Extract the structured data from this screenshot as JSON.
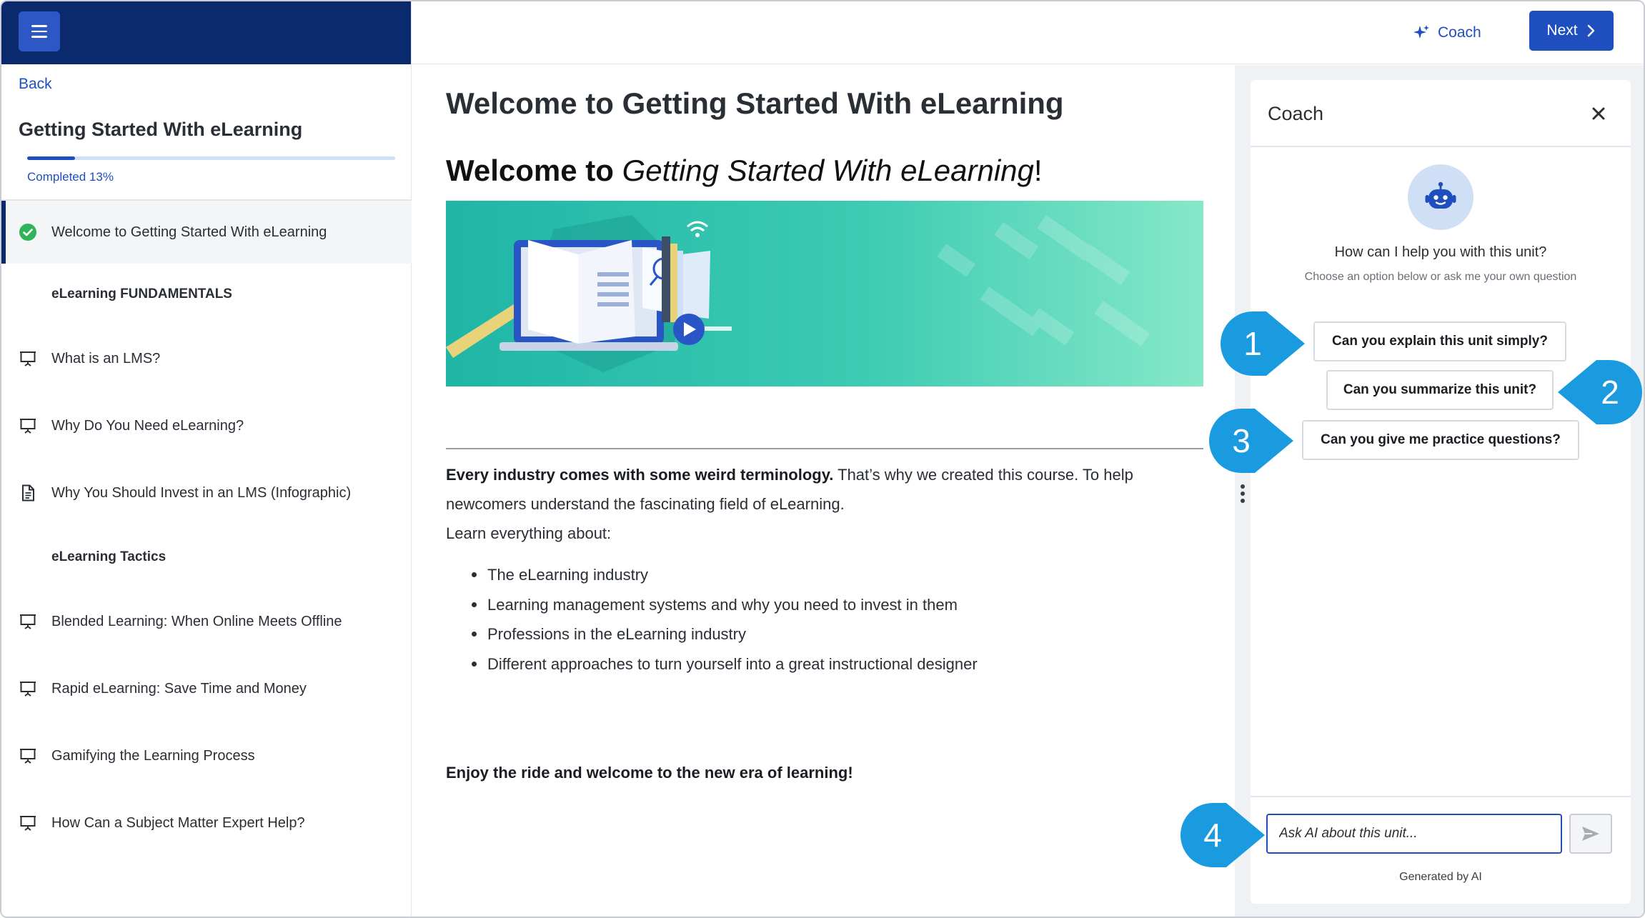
{
  "sidebar": {
    "back_label": "Back",
    "course_title": "Getting Started With eLearning",
    "progress_label": "Completed 13%",
    "progress_percent": 13,
    "items": [
      {
        "label": "Welcome to Getting Started With eLearning",
        "icon": "check-circle-icon",
        "active": true
      },
      {
        "label": "eLearning FUNDAMENTALS",
        "type": "section"
      },
      {
        "label": "What is an LMS?",
        "icon": "presentation-icon"
      },
      {
        "label": "Why Do You Need eLearning?",
        "icon": "presentation-icon"
      },
      {
        "label": "Why You Should Invest in an LMS (Infographic)",
        "icon": "document-icon"
      },
      {
        "label": "eLearning Tactics",
        "type": "section"
      },
      {
        "label": "Blended Learning: When Online Meets Offline",
        "icon": "presentation-icon"
      },
      {
        "label": "Rapid eLearning: Save Time and Money",
        "icon": "presentation-icon"
      },
      {
        "label": "Gamifying the Learning Process",
        "icon": "presentation-icon"
      },
      {
        "label": "How Can a Subject Matter Expert Help?",
        "icon": "presentation-icon"
      }
    ]
  },
  "header": {
    "coach_label": "Coach",
    "next_label": "Next"
  },
  "main": {
    "title": "Welcome to Getting Started With eLearning",
    "subtitle_bold": "Welcome to",
    "subtitle_italic": "Getting Started With eLearning",
    "subtitle_end": "!",
    "intro_bold": "Every industry comes with some weird terminology.",
    "intro_rest": "That’s why we created this course. To help newcomers understand the fascinating field of eLearning.",
    "learn_label": "Learn everything about:",
    "bullets": [
      "The eLearning industry",
      "Learning management systems and why you need to invest in them",
      "Professions in the eLearning industry",
      "Different approaches to turn yourself into a great instructional designer"
    ],
    "closing": "Enjoy the ride and welcome to the new era of learning!"
  },
  "coach": {
    "title": "Coach",
    "question": "How can I help you with this unit?",
    "subtext": "Choose an option below or ask me your own question",
    "suggestions": [
      "Can you explain this unit simply?",
      "Can you summarize this unit?",
      "Can you give me practice questions?"
    ],
    "input_placeholder": "Ask AI about this unit...",
    "footer": "Generated by AI"
  },
  "callouts": [
    "1",
    "2",
    "3",
    "4"
  ],
  "colors": {
    "navy": "#0b2a6e",
    "brand_blue": "#1f4fbf",
    "callout_blue": "#1a9be0",
    "success_green": "#2fb45a",
    "banner_teal": "#1fb6a6"
  }
}
